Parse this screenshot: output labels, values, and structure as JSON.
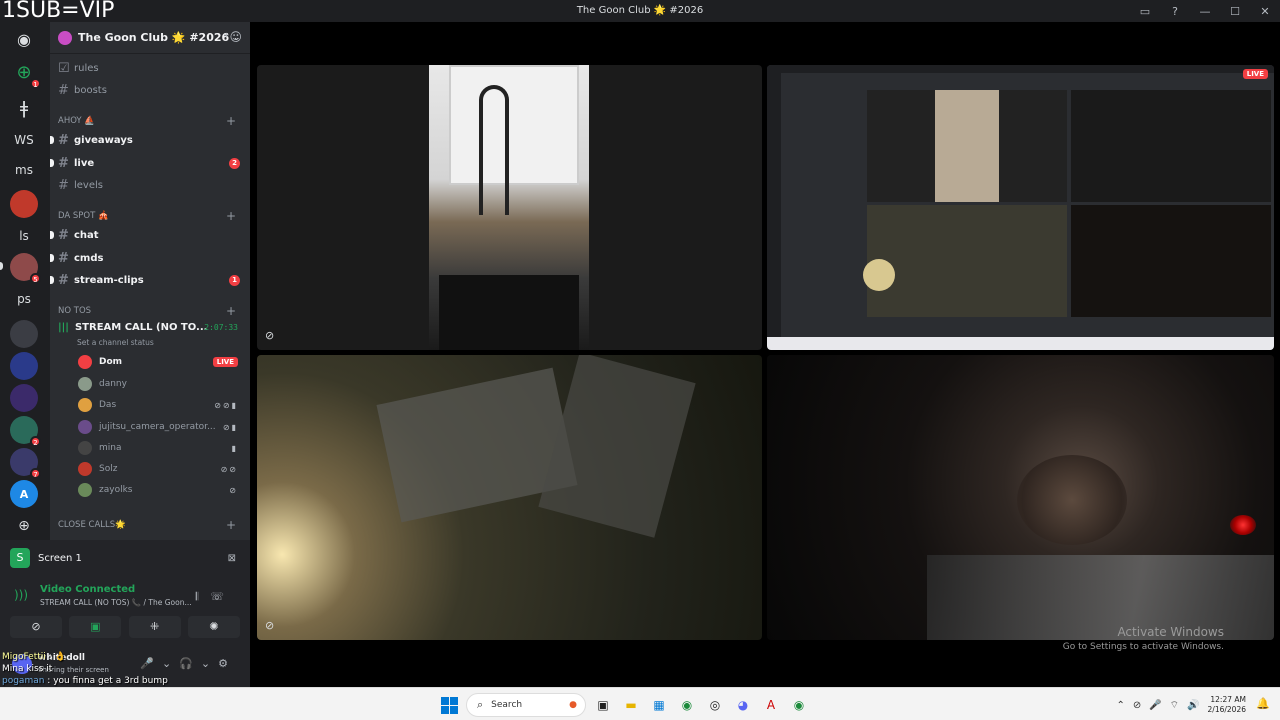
{
  "overlay": {
    "text": "1SUB=VIP"
  },
  "window": {
    "title": "The Goon Club 🌟 #2026"
  },
  "rail": {
    "servers": [
      {
        "label": "WS"
      },
      {
        "label": "ms"
      },
      {
        "label": "ls"
      },
      {
        "label": "ps"
      }
    ],
    "badges": [
      "1",
      "5",
      "2",
      "7"
    ]
  },
  "server": {
    "name": "The Goon Club 🌟 #2026"
  },
  "channels": {
    "rules": "rules",
    "boosts": "boosts",
    "cat_ahoy": "AHOY ⛵",
    "giveaways": "giveaways",
    "live": "live",
    "live_badge": "2",
    "levels": "levels",
    "cat_daspot": "DA SPOT 🎪",
    "chat": "chat",
    "cmds": "cmds",
    "stream_clips": "stream-clips",
    "stream_clips_badge": "1",
    "cat_notos": "NO TOS",
    "voice_name": "STREAM CALL (NO TO...",
    "voice_time": "2:07:33",
    "voice_status": "Set a channel status",
    "cat_close": "CLOSE CALLS🌟"
  },
  "members": [
    {
      "name": "Dom",
      "live": "LIVE",
      "color": "#f23f43"
    },
    {
      "name": "danny",
      "color": "#8a9a8a"
    },
    {
      "name": "Das",
      "color": "#e0a040"
    },
    {
      "name": "jujitsu_camera_operator...",
      "color": "#6a4c8a"
    },
    {
      "name": "mina",
      "color": "#444"
    },
    {
      "name": "Solz",
      "color": "#c0392b"
    },
    {
      "name": "zayolks",
      "color": "#6a8a5a"
    }
  ],
  "panel": {
    "screen_label": "Screen 1",
    "voice_connected": "Video Connected",
    "voice_sub": "STREAM CALL (NO TOS) 📞 / The Goon...",
    "user_name": "whitedoll",
    "user_status": "Sharing their screen"
  },
  "chat_overlay": [
    {
      "name": "MigoFettii",
      "text": "👌"
    },
    {
      "name": "",
      "text": "Mina kiss it"
    },
    {
      "name": "pogaman",
      "text": "you finna get a 3rd bump"
    }
  ],
  "stage": {
    "live_badge": "LIVE",
    "activate_title": "Activate Windows",
    "activate_sub": "Go to Settings to activate Windows."
  },
  "taskbar": {
    "search_placeholder": "Search",
    "time": "12:27 AM",
    "date": "2/16/2026"
  },
  "colors": {
    "accent_green": "#23a55a",
    "danger_red": "#f23f43",
    "blurple": "#5865f2"
  }
}
